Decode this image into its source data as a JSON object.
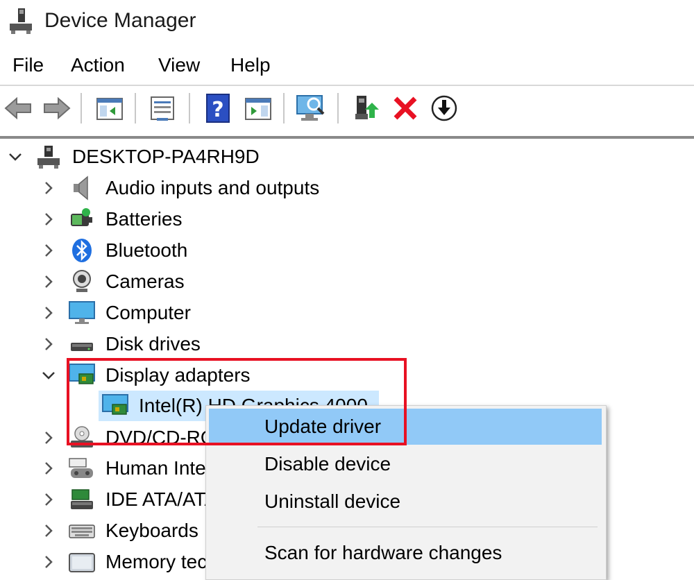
{
  "window": {
    "title": "Device Manager",
    "title_icon": "device-manager-icon"
  },
  "menubar": {
    "items": [
      "File",
      "Action",
      "View",
      "Help"
    ]
  },
  "toolbar": {
    "buttons": [
      "back-arrow-icon",
      "forward-arrow-icon",
      "show-hide-console-tree-icon",
      "properties-icon",
      "help-icon",
      "action-pane-icon",
      "scan-hardware-icon",
      "update-driver-icon",
      "uninstall-icon",
      "disable-device-icon"
    ]
  },
  "tree": {
    "root": {
      "label": "DESKTOP-PA4RH9D",
      "icon": "computer-root-icon",
      "expanded": true
    },
    "categories": [
      {
        "label": "Audio inputs and outputs",
        "icon": "speaker-icon"
      },
      {
        "label": "Batteries",
        "icon": "battery-icon"
      },
      {
        "label": "Bluetooth",
        "icon": "bluetooth-icon"
      },
      {
        "label": "Cameras",
        "icon": "webcam-icon"
      },
      {
        "label": "Computer",
        "icon": "monitor-icon"
      },
      {
        "label": "Disk drives",
        "icon": "disk-drive-icon"
      },
      {
        "label": "Display adapters",
        "icon": "display-adapter-icon",
        "expanded": true
      },
      {
        "label": "Intel(R) HD Graphics 4000",
        "icon": "display-adapter-icon",
        "child": true,
        "selected": true
      },
      {
        "label": "DVD/CD-ROM drives",
        "icon": "dvd-icon"
      },
      {
        "label": "Human Interface Devices",
        "icon": "hid-icon"
      },
      {
        "label": "IDE ATA/ATAPI controllers",
        "icon": "ide-controller-icon"
      },
      {
        "label": "Keyboards",
        "icon": "keyboard-icon"
      },
      {
        "label": "Memory technology devices",
        "icon": "memory-icon"
      }
    ]
  },
  "context_menu": {
    "items": [
      {
        "label": "Update driver",
        "hover": true
      },
      {
        "label": "Disable device"
      },
      {
        "label": "Uninstall device"
      },
      {
        "label": "Scan for hardware changes"
      }
    ]
  },
  "colors": {
    "highlight_box": "#e81123",
    "selection": "#cce8ff",
    "menu_hover": "#91c9f7"
  }
}
